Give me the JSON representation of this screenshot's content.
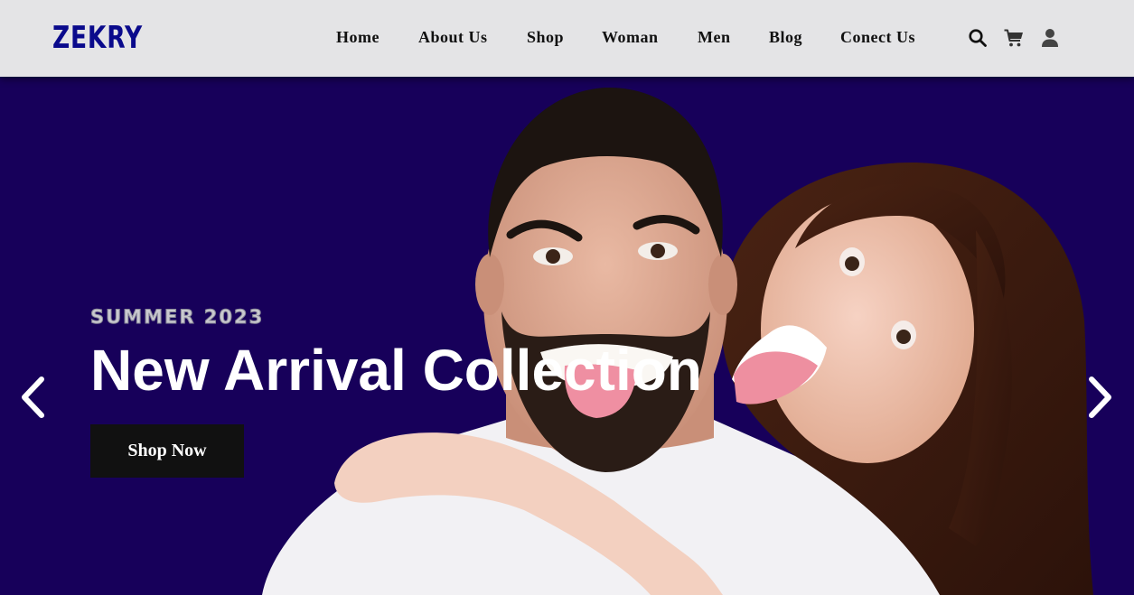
{
  "brand": {
    "logo": "ZEKRY"
  },
  "nav": {
    "items": [
      {
        "label": "Home"
      },
      {
        "label": "About Us"
      },
      {
        "label": "Shop"
      },
      {
        "label": "Woman"
      },
      {
        "label": "Men"
      },
      {
        "label": "Blog"
      },
      {
        "label": "Conect Us"
      }
    ]
  },
  "header_icons": [
    "search-icon",
    "cart-icon",
    "user-icon"
  ],
  "hero": {
    "eyebrow": "SUMMER 2023",
    "headline": "New Arrival Collection",
    "cta_label": "Shop Now",
    "background_color": "#17005a"
  },
  "colors": {
    "logo": "#0a0a8c",
    "header_bg": "#e4e4e6",
    "cta_bg": "#111111"
  }
}
